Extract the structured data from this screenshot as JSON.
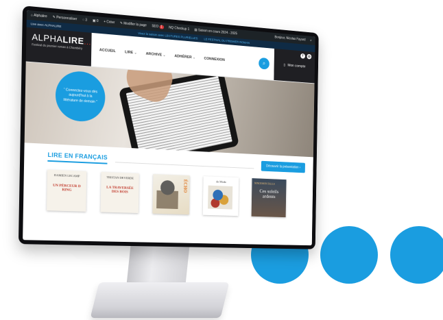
{
  "admin_bar": {
    "site": "Alphalire",
    "customize": "Personnaliser",
    "comments_count": "3",
    "updates_count": "0",
    "create": "+ Créer",
    "edit_page": "Modifier la page",
    "seo": "SEO",
    "seo_badge": "1",
    "checkup": "NQ Checkup 1",
    "season": "Saison en cours 2024 - 2025",
    "greeting": "Bonjour, Nicolas Fayard"
  },
  "notice_bar": {
    "live_label": "Live avec ALPHALIRE",
    "message_1": "Vivez la saison avec LECTURES PLURIELLES",
    "message_2": "LE FESTIVAL DU PREMIER ROMAN"
  },
  "header": {
    "logo_light": "ALPHA",
    "logo_bold": "LIRE",
    "logo_dots": "...",
    "tagline": "Festival du premier roman à Chambéry",
    "nav": [
      {
        "label": "ACCUEIL"
      },
      {
        "label": "LIRE"
      },
      {
        "label": "ARCHIVE"
      },
      {
        "label": "ADHÉRER"
      },
      {
        "label": "CONNEXION"
      }
    ],
    "account_label": "Mon compte"
  },
  "hero": {
    "bubble_text": "“ Connectez-vous dès aujourd'hui à la littérature de demain ”"
  },
  "section": {
    "title": "LIRE EN FRANÇAIS",
    "button": "Découvrir la présentation"
  },
  "books": [
    {
      "author": "DAMIEN LECAMP",
      "title": "UN PÉRCEUR D RING"
    },
    {
      "author": "TRISTAN DEVERDE",
      "title": "LA TRAVERSÉE DES BOIS"
    },
    {
      "author": "",
      "title": "ÉCHO"
    },
    {
      "author": "de Moda",
      "title": ""
    },
    {
      "author": "NINCEMON FALLS",
      "title": "Ces soleils ardents"
    }
  ],
  "colors": {
    "accent": "#1a9de0",
    "dark": "#1f1f23",
    "logo_dots": "#e73a2f"
  }
}
